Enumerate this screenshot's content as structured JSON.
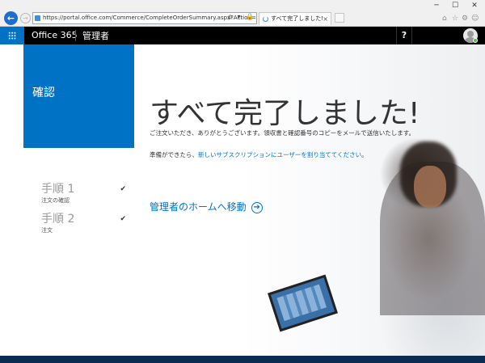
{
  "browser": {
    "back_glyph": "←",
    "forward_glyph": "→",
    "url": "https://portal.office.com/Commerce/CompleteOrderSummary.aspx?Action=BuyOffer&Return=Ho",
    "address_tools": "ρ ▾ 🔒 ↻",
    "tab_title": "すべて完了しました!",
    "tab_close": "×",
    "window_minimize": "─",
    "window_maximize": "☐",
    "window_close": "✕",
    "home_icon": "⌂",
    "favorites_icon": "☆",
    "settings_icon": "⚙",
    "feedback_icon": "☺"
  },
  "suitebar": {
    "brand": "Office 365",
    "app": "管理者",
    "help": "?"
  },
  "sidebar": {
    "section_title": "確認",
    "steps": [
      {
        "title": "手順 1",
        "subtitle": "注文の確認",
        "check": "✔"
      },
      {
        "title": "手順 2",
        "subtitle": "注文",
        "check": "✔"
      }
    ]
  },
  "main": {
    "headline": "すべて完了しました!",
    "thanks_text": "ご注文いただき、ありがとうございます。領収書と確認番号のコピーをメールで送信いたします。",
    "ready_prefix": "準備ができたら、",
    "ready_link": "新しいサブスクリプションにユーザーを割り当ててください",
    "ready_suffix": "。",
    "home_link": "管理者のホームへ移動",
    "home_arrow": "➔"
  },
  "colors": {
    "accent": "#0072c6",
    "suitebar": "#000000"
  }
}
